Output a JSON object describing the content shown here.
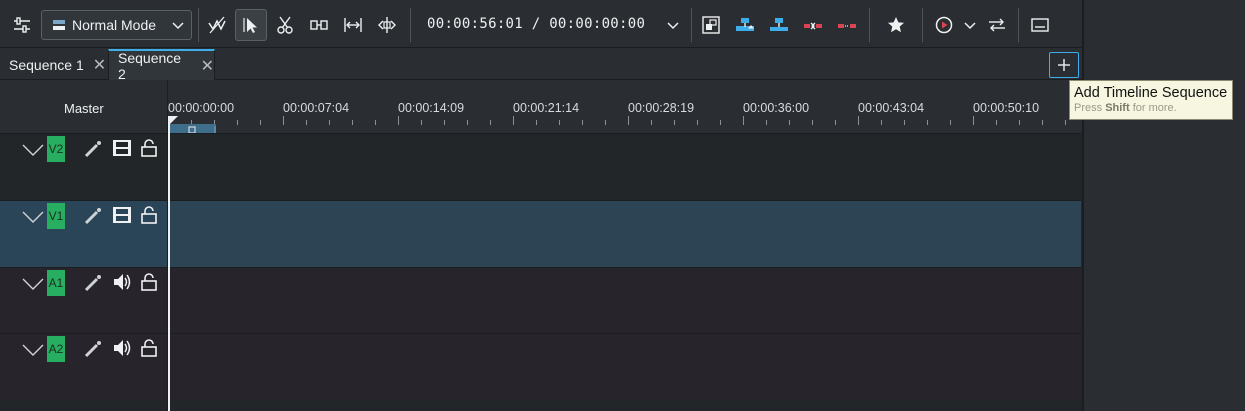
{
  "toolbar": {
    "mode_label": "Normal Mode",
    "timecode_text": "00:00:56:01 / 00:00:00:00",
    "buttons": [
      "timeline-settings-icon",
      "spacer-tool-icon",
      "select-tool-icon",
      "razor-tool-icon",
      "slip-tool-icon",
      "ripple-tool-icon",
      "multicam-tool-icon",
      "overwrite-mode-icon",
      "insert-icon",
      "overwrite-icon",
      "extract-icon",
      "lift-icon",
      "favorite-icon",
      "preview-render-icon",
      "mixer-icon",
      "subtitle-icon"
    ]
  },
  "tabs": [
    {
      "label": "Sequence 1",
      "active": false
    },
    {
      "label": "Sequence 2",
      "active": true
    }
  ],
  "add_sequence_tooltip": {
    "title": "Add Timeline Sequence",
    "hint_prefix": "Press ",
    "hint_key": "Shift",
    "hint_suffix": " for more."
  },
  "header": {
    "master_label": "Master"
  },
  "ruler_labels": [
    "00:00:00:00",
    "00:00:07:04",
    "00:00:14:09",
    "00:00:21:14",
    "00:00:28:19",
    "00:00:36:00",
    "00:00:43:04",
    "00:00:50:10"
  ],
  "tracks": [
    {
      "name": "V2",
      "kind": "video",
      "selected": false
    },
    {
      "name": "V1",
      "kind": "video",
      "selected": true
    },
    {
      "name": "A1",
      "kind": "audio",
      "selected": false
    },
    {
      "name": "A2",
      "kind": "audio",
      "selected": false
    }
  ],
  "colors": {
    "accent": "#3daee9",
    "track_tag": "#27ae60",
    "selected_track": "#2c4454"
  }
}
